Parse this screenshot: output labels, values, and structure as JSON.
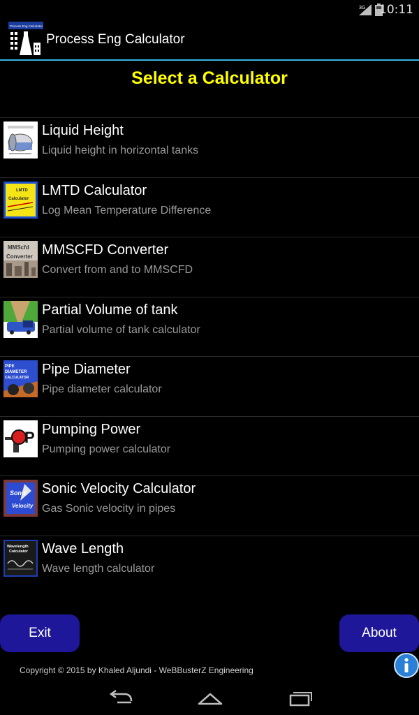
{
  "status_bar": {
    "time": "10:11",
    "network": "3G"
  },
  "app": {
    "title": "Process Eng Calculator",
    "icon_caption": "Process Eng Calculator"
  },
  "page": {
    "title": "Select a Calculator"
  },
  "calculators": [
    {
      "title": "Liquid Height",
      "subtitle": "Liquid height in horizontal tanks",
      "icon": "horizontal-tank-icon"
    },
    {
      "title": "LMTD Calculator",
      "subtitle": "Log Mean Temperature Difference",
      "icon": "lmtd-icon",
      "icon_text": [
        "LMTD",
        "Calculator"
      ]
    },
    {
      "title": "MMSCFD Converter",
      "subtitle": "Convert from and to MMSCFD",
      "icon": "mmscfd-icon",
      "icon_text": [
        "MMScfd",
        "Converter"
      ]
    },
    {
      "title": "Partial Volume of tank",
      "subtitle": "Partial volume of tank calculator",
      "icon": "partial-volume-icon"
    },
    {
      "title": "Pipe Diameter",
      "subtitle": "Pipe diameter calculator",
      "icon": "pipe-diameter-icon",
      "icon_text": [
        "PIPE",
        "DIAMETER",
        "CALCULATOR"
      ]
    },
    {
      "title": "Pumping Power",
      "subtitle": "Pumping power calculator",
      "icon": "pump-icon",
      "icon_text": [
        "P"
      ]
    },
    {
      "title": "Sonic Velocity Calculator",
      "subtitle": "Gas Sonic velocity in pipes",
      "icon": "sonic-velocity-icon",
      "icon_text": [
        "Sonic",
        "Velocity"
      ]
    },
    {
      "title": "Wave Length",
      "subtitle": "Wave length calculator",
      "icon": "wave-length-icon",
      "icon_text": [
        "Wavelength",
        "Calculator"
      ]
    }
  ],
  "buttons": {
    "exit": "Exit",
    "about": "About"
  },
  "footer": {
    "copyright": "Copyright © 2015 by Khaled Aljundi - WeBBusterZ Engineering"
  },
  "colors": {
    "accent": "#33b5e5",
    "title": "#ffff00",
    "button": "#1f1799",
    "background": "#000000"
  }
}
